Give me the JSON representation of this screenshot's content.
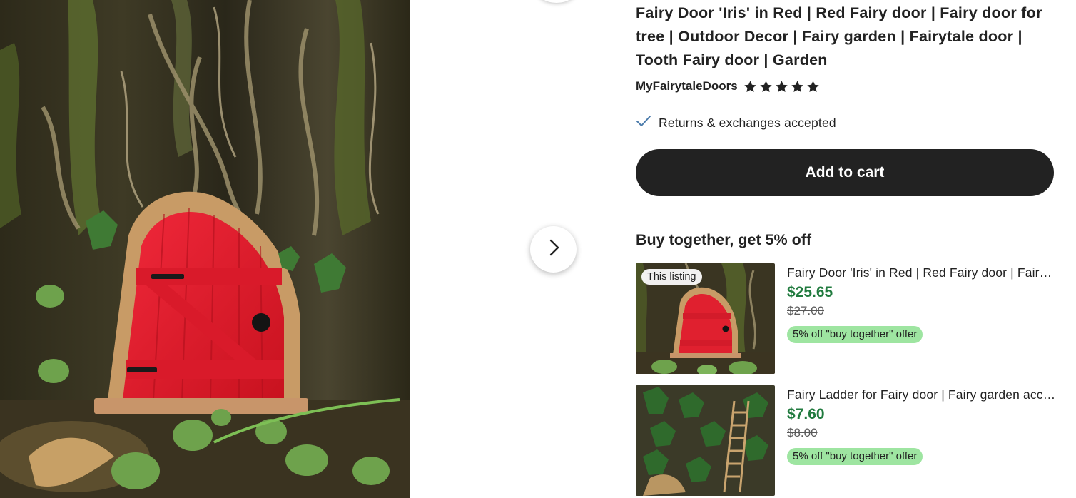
{
  "listing": {
    "title": "Fairy Door 'Iris' in Red | Red Fairy door | Fairy door for tree | Outdoor Decor | Fairy garden | Fairytale door | Tooth Fairy door | Garden",
    "shop_name": "MyFairytaleDoors",
    "rating_stars": 5,
    "returns_label": "Returns & exchanges accepted",
    "add_to_cart_label": "Add to cart"
  },
  "gallery": {
    "next_icon": "chevron-right-icon"
  },
  "bundle": {
    "heading": "Buy together, get 5% off",
    "items": [
      {
        "badge": "This listing",
        "name": "Fairy Door 'Iris' in Red | Red Fairy door | Fairy door for tree",
        "price": "$25.65",
        "original_price": "$27.00",
        "offer": "5% off \"buy together\" offer"
      },
      {
        "name": "Fairy Ladder for Fairy door | Fairy garden accessory",
        "price": "$7.60",
        "original_price": "$8.00",
        "offer": "5% off \"buy together\" offer"
      }
    ]
  },
  "colors": {
    "accent_price": "#217b3f",
    "button_bg": "#222222",
    "offer_badge": "#9ee5a1",
    "door_red": "#e0202f"
  }
}
